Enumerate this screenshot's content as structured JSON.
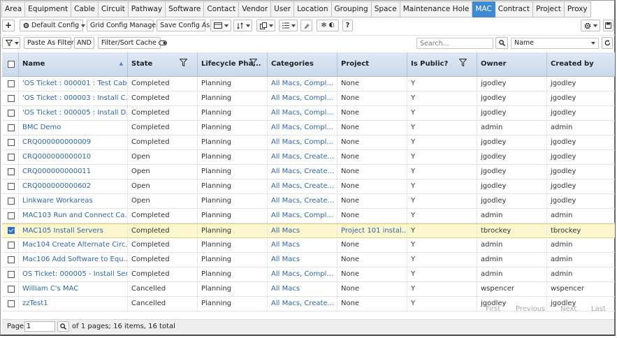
{
  "tabs": [
    "Area",
    "Equipment",
    "Cable",
    "Circuit",
    "Pathway",
    "Software",
    "Contact",
    "Vendor",
    "User",
    "Location",
    "Grouping",
    "Space",
    "Maintenance Hole",
    "MAC",
    "Contract",
    "Project",
    "Proxy"
  ],
  "active_tab": "MAC",
  "toolbar": {
    "add": "+",
    "default_config": "Default Config",
    "grid_config_manager": "Grid Config Manager",
    "save_config_as": "Save Config As",
    "help": "?"
  },
  "filterbar": {
    "paste_as_filter": "Paste As Filter",
    "and": "AND",
    "filter_sort_cache": "Filter/Sort Cache",
    "search_placeholder": "Search...",
    "search_field": "Name"
  },
  "columns": [
    "Name",
    "State",
    "Lifecycle Pha...",
    "Categories",
    "Project",
    "Is Public?",
    "Owner",
    "Created by"
  ],
  "rows": [
    {
      "name": "'OS Ticket : 000001 : Test Cab...",
      "state": "Completed",
      "lifecycle": "Planning",
      "categories": "All Macs,  Compl...",
      "project": "None",
      "public": "Y",
      "owner": "jgodley",
      "created": "jgodley",
      "checked": false
    },
    {
      "name": "'OS Ticket : 000003 : Install C...",
      "state": "Completed",
      "lifecycle": "Planning",
      "categories": "All Macs,  Compl...",
      "project": "None",
      "public": "Y",
      "owner": "jgodley",
      "created": "jgodley",
      "checked": false
    },
    {
      "name": "'OS Ticket : 000005 : Install D...",
      "state": "Completed",
      "lifecycle": "Planning",
      "categories": "All Macs,  Compl...",
      "project": "None",
      "public": "Y",
      "owner": "jgodley",
      "created": "jgodley",
      "checked": false
    },
    {
      "name": "BMC Demo",
      "state": "Completed",
      "lifecycle": "Planning",
      "categories": "All Macs,  Compl...",
      "project": "None",
      "public": "Y",
      "owner": "admin",
      "created": "admin",
      "checked": false
    },
    {
      "name": "CRQ000000000009",
      "state": "Completed",
      "lifecycle": "Planning",
      "categories": "All Macs,  Compl...",
      "project": "None",
      "public": "Y",
      "owner": "jgodley",
      "created": "jgodley",
      "checked": false
    },
    {
      "name": "CRQ000000000010",
      "state": "Open",
      "lifecycle": "Planning",
      "categories": "All Macs,  Create...",
      "project": "None",
      "public": "Y",
      "owner": "jgodley",
      "created": "jgodley",
      "checked": false
    },
    {
      "name": "CRQ000000000011",
      "state": "Open",
      "lifecycle": "Planning",
      "categories": "All Macs,  Create...",
      "project": "None",
      "public": "Y",
      "owner": "jgodley",
      "created": "jgodley",
      "checked": false
    },
    {
      "name": "CRQ000000000602",
      "state": "Open",
      "lifecycle": "Planning",
      "categories": "All Macs,  Create...",
      "project": "None",
      "public": "Y",
      "owner": "jgodley",
      "created": "jgodley",
      "checked": false
    },
    {
      "name": "Linkware Workareas",
      "state": "Open",
      "lifecycle": "Planning",
      "categories": "All Macs,  Create...",
      "project": "None",
      "public": "Y",
      "owner": "jgodley",
      "created": "jgodley",
      "checked": false
    },
    {
      "name": "MAC103 Run and Connect Ca...",
      "state": "Completed",
      "lifecycle": "Planning",
      "categories": "All Macs,  Compl...",
      "project": "None",
      "public": "Y",
      "owner": "admin",
      "created": "admin",
      "checked": false
    },
    {
      "name": "MAC105 Install Servers",
      "state": "Completed",
      "lifecycle": "Planning",
      "categories": "All Macs",
      "project": "Project 101 instal...",
      "public": "Y",
      "owner": "tbrockey",
      "created": "tbrockey",
      "checked": true
    },
    {
      "name": "Mac104 Create Alternate Circ...",
      "state": "Completed",
      "lifecycle": "Planning",
      "categories": "All Macs",
      "project": "None",
      "public": "Y",
      "owner": "admin",
      "created": "admin",
      "checked": false
    },
    {
      "name": "Mac106 Add Software to Equ...",
      "state": "Completed",
      "lifecycle": "Planning",
      "categories": "All Macs",
      "project": "None",
      "public": "Y",
      "owner": "admin",
      "created": "admin",
      "checked": false
    },
    {
      "name": "OS Ticket: 000005 - Install Ser...",
      "state": "Completed",
      "lifecycle": "Planning",
      "categories": "All Macs,  Compl...",
      "project": "None",
      "public": "Y",
      "owner": "admin",
      "created": "admin",
      "checked": false
    },
    {
      "name": "William C's MAC",
      "state": "Cancelled",
      "lifecycle": "Planning",
      "categories": "All Macs",
      "project": "None",
      "public": "Y",
      "owner": "wspencer",
      "created": "wspencer",
      "checked": false
    },
    {
      "name": "zzTest1",
      "state": "Cancelled",
      "lifecycle": "Planning",
      "categories": "All Macs,  Create...",
      "project": "None",
      "public": "Y",
      "owner": "jgodley",
      "created": "jgodley",
      "checked": false
    }
  ],
  "pager": {
    "first": "First",
    "previous": "Previous",
    "next": "Next",
    "last": "Last"
  },
  "footer": {
    "page_label": "Page",
    "page_value": "1",
    "of_pages": "of 1 pages; 16 items, 16 total"
  }
}
